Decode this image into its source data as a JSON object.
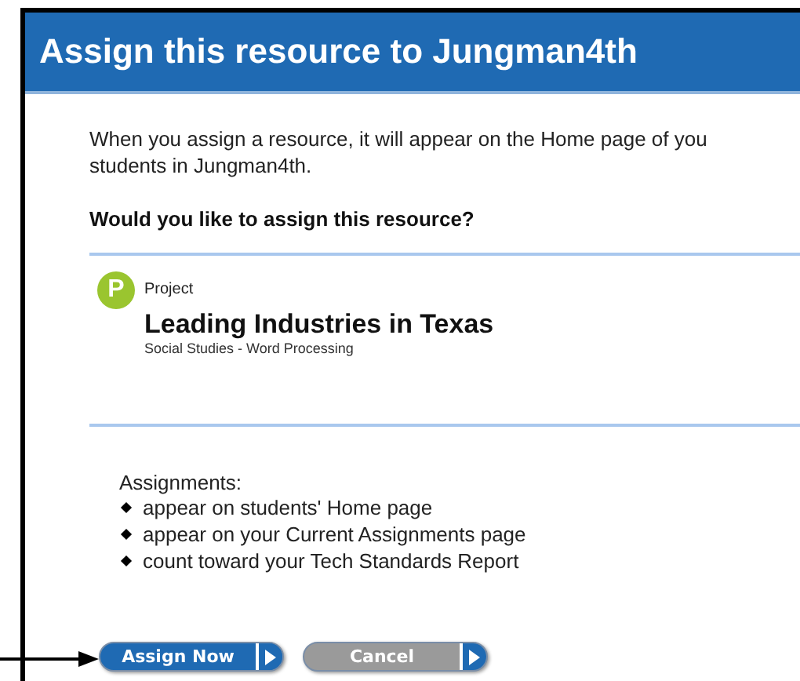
{
  "dialog": {
    "title": "Assign this resource to Jungman4th",
    "intro": "When you assign a resource, it will appear on the Home page of you",
    "intro_line2": "students in Jungman4th.",
    "question": "Would you like to assign this resource?",
    "resource": {
      "badge": "P",
      "type": "Project",
      "title": "Leading Industries in Texas",
      "subtitle": "Social Studies - Word Processing"
    },
    "assignments_label": "Assignments:",
    "assignments": [
      "appear on students' Home page",
      "appear on your Current Assignments page",
      "count toward your Tech Standards Report"
    ],
    "buttons": [
      {
        "label": "Assign Now",
        "kind": "primary"
      },
      {
        "label": "Cancel",
        "kind": "secondary"
      }
    ]
  }
}
